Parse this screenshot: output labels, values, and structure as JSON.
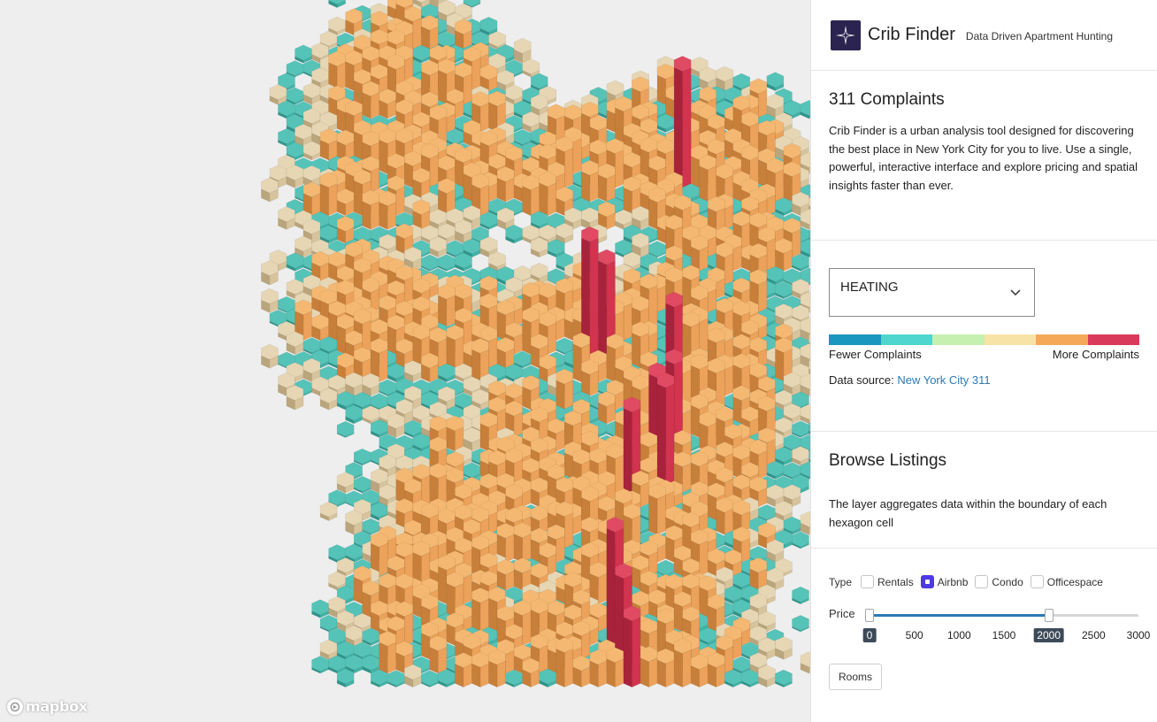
{
  "header": {
    "app_name": "Crib Finder",
    "tagline": "Data Driven Apartment Hunting",
    "logo_icon": "compass-star-icon"
  },
  "complaints": {
    "title": "311 Complaints",
    "description": "Crib Finder is a urban analysis tool designed for discovering the best place in New York City for you to live. Use a single, powerful, interactive interface and explore pricing and spatial insights faster than ever.",
    "category_select": {
      "selected": "HEATING"
    },
    "color_scale": [
      "#1a97bf",
      "#4fd6cf",
      "#c6f0b0",
      "#f8e3a6",
      "#f5a958",
      "#d9395a"
    ],
    "legend_low": "Fewer Complaints",
    "legend_high": "More Complaints",
    "data_source_label": "Data source:",
    "data_source_link": "New York City 311"
  },
  "browse": {
    "title": "Browse Listings",
    "description": "The layer aggregates data within the boundary of each hexagon cell"
  },
  "filters": {
    "type_label": "Type",
    "types": [
      {
        "label": "Rentals",
        "checked": false
      },
      {
        "label": "Airbnb",
        "checked": true
      },
      {
        "label": "Condo",
        "checked": false
      },
      {
        "label": "Officespace",
        "checked": false
      }
    ],
    "price": {
      "label": "Price",
      "min": 0,
      "max": 3000,
      "low": 0,
      "high": 2000,
      "ticks": [
        "0",
        "500",
        "1000",
        "1500",
        "2000",
        "2500",
        "3000"
      ]
    },
    "rooms_button": "Rooms"
  },
  "map": {
    "attribution": "mapbox",
    "hex_colors": {
      "teal": "#3fb3a7",
      "tan": "#d8c49c",
      "orange": "#eca25a",
      "red": "#d2334f"
    }
  }
}
